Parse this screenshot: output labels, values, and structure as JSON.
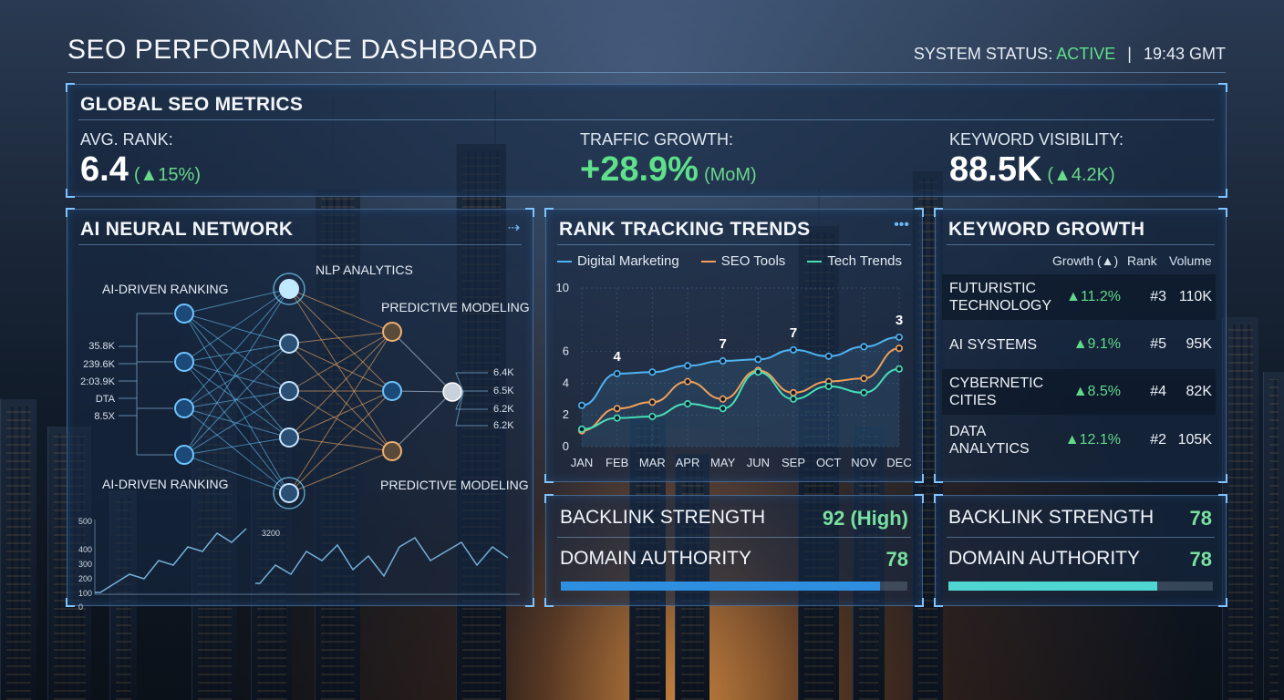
{
  "header": {
    "title": "SEO PERFORMANCE DASHBOARD",
    "status_label": "SYSTEM STATUS:",
    "status_value": "ACTIVE",
    "separator": "|",
    "time": "19:43 GMT"
  },
  "global_metrics": {
    "title": "GLOBAL SEO METRICS",
    "avg_rank": {
      "label": "AVG. RANK:",
      "value": "6.4",
      "delta": "(▲15%)"
    },
    "traffic": {
      "label": "TRAFFIC GROWTH:",
      "value": "+28.9%",
      "delta": "(MoM)"
    },
    "visibility": {
      "label": "KEYWORD VISIBILITY:",
      "value": "88.5K",
      "delta": "(▲4.2K)"
    }
  },
  "neural": {
    "title": "AI NEURAL NETWORK",
    "labels": {
      "top_left": "AI-DRIVEN RANKING",
      "bottom_left": "AI-DRIVEN RANKING",
      "top_mid": "NLP ANALYTICS",
      "top_right": "PREDICTIVE MODELING",
      "bottom_right": "PREDICTIVE MODELING"
    },
    "inputs": [
      "35.8K",
      "239.6K",
      "2:03.9K",
      "DTA",
      "8.5X"
    ],
    "outputs": [
      "6.4K",
      "6.5K",
      "6.2K",
      "6.2K"
    ],
    "mini_chart": {
      "yticks": [
        "500",
        "400",
        "300",
        "200",
        "100",
        "0"
      ],
      "annotation": "3200"
    }
  },
  "rank_trends": {
    "title": "RANK TRACKING TRENDS",
    "more_icon": "ellipsis-icon"
  },
  "chart_data": {
    "type": "line",
    "title": "RANK TRACKING TRENDS",
    "categories": [
      "JAN",
      "FEB",
      "MAR",
      "APR",
      "MAY",
      "JUN",
      "SEP",
      "OCT",
      "NOV",
      "DEC"
    ],
    "ylim": [
      0,
      10
    ],
    "yticks": [
      "10",
      "6",
      "4",
      "2",
      "0"
    ],
    "series": [
      {
        "name": "Digital Marketing",
        "color": "#4fb3f3",
        "values": [
          2.6,
          4.6,
          4.7,
          5.1,
          5.4,
          5.5,
          6.1,
          5.7,
          6.3,
          6.9
        ]
      },
      {
        "name": "SEO Tools",
        "color": "#f0a05a",
        "values": [
          1.0,
          2.4,
          2.8,
          4.1,
          3.0,
          4.8,
          3.4,
          4.1,
          4.3,
          6.2
        ]
      },
      {
        "name": "Tech Trends",
        "color": "#48e0b8",
        "values": [
          1.1,
          1.8,
          1.9,
          2.7,
          2.4,
          4.7,
          3.0,
          3.8,
          3.4,
          4.9
        ]
      }
    ],
    "annotations": [
      {
        "x": "FEB",
        "label": "4"
      },
      {
        "x": "MAY",
        "label": "7"
      },
      {
        "x": "SEP",
        "label": "7"
      },
      {
        "x": "DEC",
        "label": "3"
      }
    ]
  },
  "keyword_growth": {
    "title": "KEYWORD GROWTH",
    "headers": {
      "growth": "Growth (▲)",
      "rank": "Rank",
      "volume": "Volume"
    },
    "rows": [
      {
        "name": "FUTURISTIC TECHNOLOGY",
        "growth": "▲11.2%",
        "rank": "#3",
        "volume": "110K"
      },
      {
        "name": "AI SYSTEMS",
        "growth": "▲9.1%",
        "rank": "#5",
        "volume": "95K"
      },
      {
        "name": "CYBERNETIC CITIES",
        "growth": "▲8.5%",
        "rank": "#4",
        "volume": "82K"
      },
      {
        "name": "DATA ANALYTICS",
        "growth": "▲12.1%",
        "rank": "#2",
        "volume": "105K"
      }
    ]
  },
  "strength_a": {
    "backlink": {
      "label": "BACKLINK STRENGTH",
      "value": "92 (High)"
    },
    "authority": {
      "label": "DOMAIN AUTHORITY",
      "value": "78",
      "fill": 0.92,
      "color": "#2e8fe0"
    }
  },
  "strength_b": {
    "backlink": {
      "label": "BACKLINK STRENGTH",
      "value": "78"
    },
    "authority": {
      "label": "DOMAIN AUTHORITY",
      "value": "78",
      "fill": 0.79,
      "color": "#4fd6d0"
    }
  }
}
